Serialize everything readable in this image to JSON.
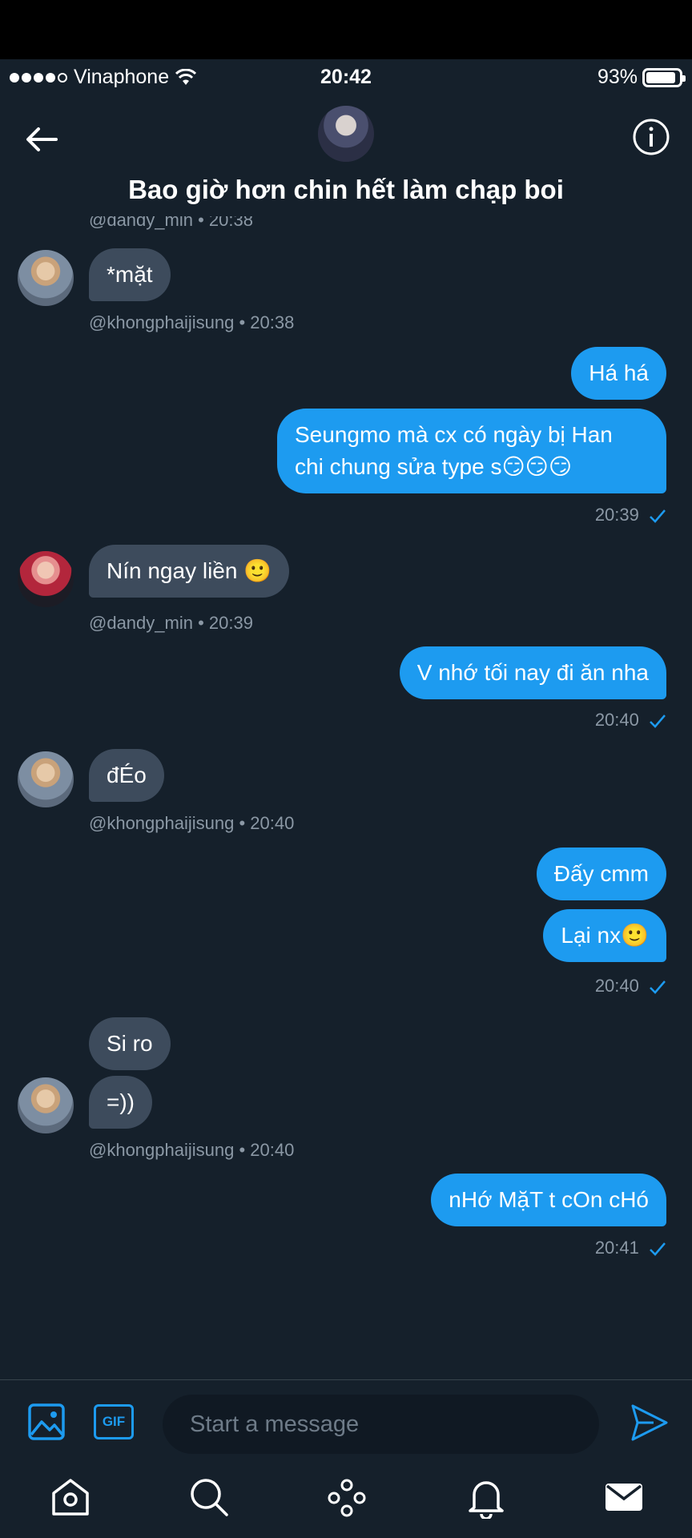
{
  "status_bar": {
    "carrier": "Vinaphone",
    "time": "20:42",
    "battery": "93%",
    "battery_level": 0.93
  },
  "header": {
    "title": "Bao giờ hơn chin hết làm chạp boi"
  },
  "messages": {
    "top_meta": "@dandy_min • 20:38",
    "m1": "*mặt",
    "m1_meta": "@khongphaijisung • 20:38",
    "m2": "Há há",
    "m3_line1": "Seungmo mà cx có ngày bị Han",
    "m3_line2": "chi chung sửa type s",
    "m3_emoji": "😏😏😏",
    "out_time_1": "20:39",
    "m4": "Nín ngay liền ",
    "m4_emoji": "🙂",
    "m4_meta": "@dandy_min • 20:39",
    "m5": "V nhớ tối nay đi ăn nha",
    "out_time_2": "20:40",
    "m6": "đÉo",
    "m6_meta": "@khongphaijisung • 20:40",
    "m7": "Đấy cmm",
    "m8": "Lại nx",
    "m8_emoji": "🙂",
    "out_time_3": "20:40",
    "m9": "Si ro",
    "m10": "=))",
    "m10_meta": "@khongphaijisung • 20:40",
    "m11": "nHớ MặT t cOn cHó",
    "out_time_4": "20:41"
  },
  "composer": {
    "gif_label": "GIF",
    "placeholder": "Start a message"
  },
  "colors": {
    "background": "#15202b",
    "accent": "#1d9bf0",
    "incoming_bubble": "#3d4b5c",
    "meta_text": "#8b98a5"
  },
  "icons": {
    "back": "arrow-left-icon",
    "info": "info-icon",
    "image": "image-icon",
    "gif": "gif-icon",
    "send": "send-icon",
    "tabs": [
      "home-icon",
      "search-icon",
      "spaces-icon",
      "bell-icon",
      "mail-icon"
    ]
  }
}
